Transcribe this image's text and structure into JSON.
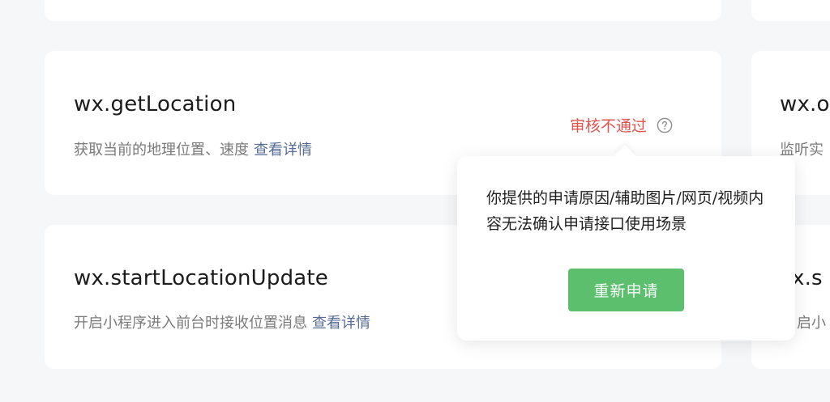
{
  "cards": [
    {
      "name": "wx.getLocation",
      "desc": "获取当前的地理位置、速度",
      "link": "查看详情",
      "status": "审核不通过"
    },
    {
      "name": "wx.startLocationUpdate",
      "desc": "开启小程序进入前台时接收位置消息",
      "link": "查看详情"
    }
  ],
  "right_column": [
    {
      "name_partial": "wx.o",
      "desc_partial": "监听实"
    },
    {
      "name_partial": "x.s",
      "desc_partial": "启小"
    }
  ],
  "popover": {
    "message": "你提供的申请原因/辅助图片/网页/视频内容无法确认申请接口使用场景",
    "button_label": "重新申请"
  },
  "colors": {
    "status_rejected": "#e3534d",
    "link": "#576b95",
    "primary_button": "#5cbf6e",
    "background": "#f6f7f9"
  },
  "icons": {
    "help": "question-circle-icon"
  }
}
